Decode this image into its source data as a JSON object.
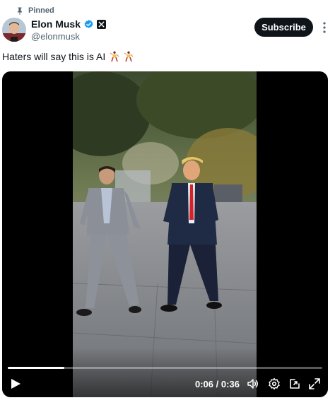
{
  "pinned": {
    "label": "Pinned"
  },
  "author": {
    "name": "Elon Musk",
    "handle": "@elonmusk"
  },
  "actions": {
    "subscribe_label": "Subscribe"
  },
  "tweet": {
    "text": "Haters will say this is AI"
  },
  "video": {
    "progress_fraction": 0.18,
    "current_time": "0:06",
    "separator": "/",
    "duration": "0:36"
  },
  "colors": {
    "text": "#0f1419",
    "secondary": "#536471",
    "verified": "#1d9bf0"
  },
  "icons": [
    "pin-icon",
    "verified-badge-icon",
    "x-affiliate-icon",
    "more-icon",
    "dancer-emoji-icon",
    "play-icon",
    "volume-icon",
    "settings-icon",
    "pip-icon",
    "fullscreen-icon"
  ]
}
